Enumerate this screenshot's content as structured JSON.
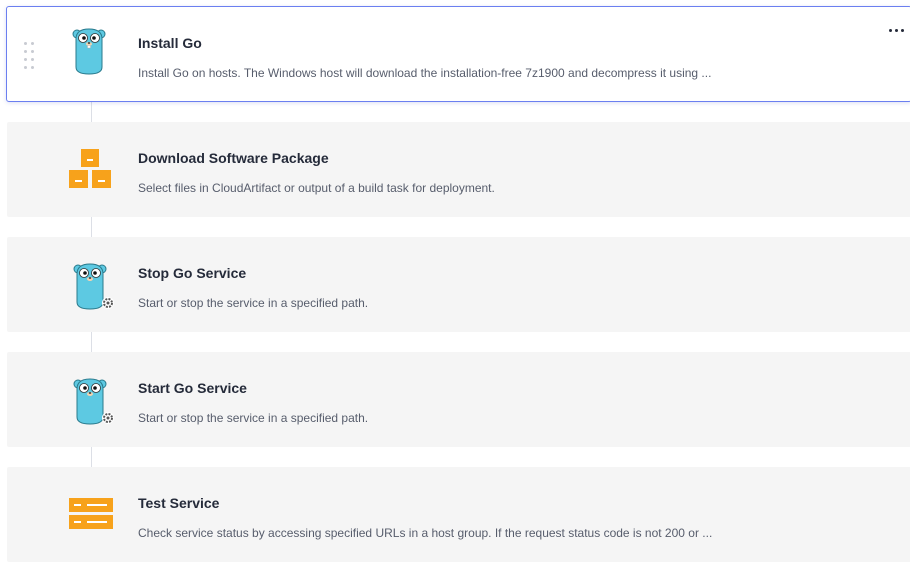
{
  "steps": [
    {
      "title": "Install Go",
      "description": "Install Go on hosts. The Windows host will download the installation-free 7z1900 and decompress it using ...",
      "icon": "go-gopher-icon",
      "active": true
    },
    {
      "title": "Download Software Package",
      "description": "Select files in CloudArtifact or output of a build task for deployment.",
      "icon": "package-boxes-icon",
      "active": false
    },
    {
      "title": "Stop Go Service",
      "description": "Start or stop the service in a specified path.",
      "icon": "go-gopher-gear-icon",
      "active": false
    },
    {
      "title": "Start Go Service",
      "description": "Start or stop the service in a specified path.",
      "icon": "go-gopher-gear-icon",
      "active": false
    },
    {
      "title": "Test Service",
      "description": "Check service status by accessing specified URLs in a host group. If the request status code is not 200 or ...",
      "icon": "service-test-icon",
      "active": false
    }
  ],
  "colors": {
    "accent_border": "#6b7ff0",
    "gopher_body": "#5dc9e2",
    "package_orange": "#f7a21b",
    "card_bg": "#f5f5f5"
  }
}
